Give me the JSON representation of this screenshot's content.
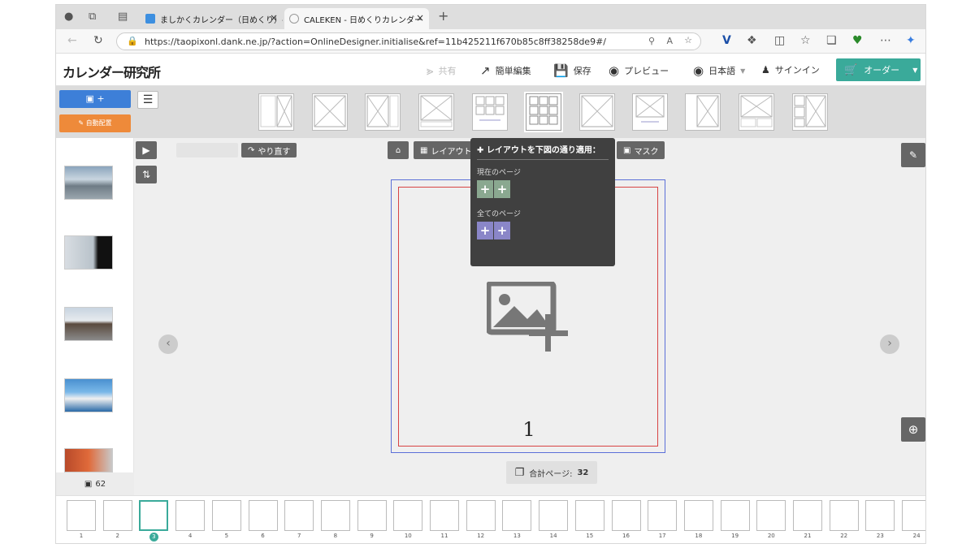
{
  "browser": {
    "tab1_title": "ましかくカレンダー（日めくり）-",
    "tab2_title": "CALEKEN - 日めくりカレンダー",
    "close_glyph": "×",
    "new_tab_glyph": "+",
    "url": "https://taopixonl.dank.ne.jp/?action=OnlineDesigner.initialise&ref=11b425211f670b85c8ff38258de9#/"
  },
  "header": {
    "logo": "カレンダー研究所",
    "share": "共有",
    "quick_edit": "簡単編集",
    "save": "保存",
    "preview": "プレビュー",
    "language": "日本語",
    "signin": "サインイン",
    "order": "オーダー"
  },
  "toolbar": {
    "add_photo": "+",
    "auto_place": "自動配置"
  },
  "canvas_tools": {
    "redo": "やり直す",
    "layout": "レイアウト",
    "mask": "マスク"
  },
  "popup": {
    "title": "レイアウトを下図の通り適用：",
    "current_page": "現在のページ",
    "all_pages": "全てのページ",
    "plus": "+"
  },
  "canvas": {
    "page_number": "1",
    "total_pages_label": "合計ページ:",
    "total_pages_value": "32"
  },
  "sidebar": {
    "image_count": "62"
  },
  "filmstrip": {
    "pages": [
      "1",
      "2",
      "3",
      "4",
      "5",
      "6",
      "7",
      "8",
      "9",
      "10",
      "11",
      "12",
      "13",
      "14",
      "15",
      "16",
      "17",
      "18",
      "19",
      "20",
      "21",
      "22",
      "23",
      "24"
    ],
    "selected": "3"
  },
  "colors": {
    "accent": "#3aaa9a",
    "add_button": "#3d7fd8",
    "auto_button": "#ee8a3a",
    "bleed": "#d84444",
    "page_border": "#5b6fd8"
  }
}
